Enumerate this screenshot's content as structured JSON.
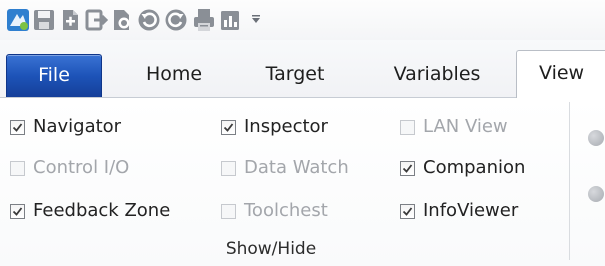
{
  "quick_access": {
    "icons": [
      "app-logo-icon",
      "save-icon",
      "add-file-icon",
      "export-icon",
      "settings-file-icon",
      "undo-icon",
      "redo-icon",
      "print-icon",
      "chart-icon",
      "customize-dropdown-icon"
    ]
  },
  "tabs": [
    {
      "label": "File"
    },
    {
      "label": "Home"
    },
    {
      "label": "Target"
    },
    {
      "label": "Variables"
    },
    {
      "label": "View"
    }
  ],
  "show_hide": {
    "group_label": "Show/Hide",
    "items": [
      {
        "label": "Navigator",
        "checked": true,
        "enabled": true
      },
      {
        "label": "Control I/O",
        "checked": false,
        "enabled": false
      },
      {
        "label": "Feedback Zone",
        "checked": true,
        "enabled": true
      },
      {
        "label": "Inspector",
        "checked": true,
        "enabled": true
      },
      {
        "label": "Data Watch",
        "checked": false,
        "enabled": false
      },
      {
        "label": "Toolchest",
        "checked": false,
        "enabled": false
      },
      {
        "label": "LAN View",
        "checked": false,
        "enabled": false
      },
      {
        "label": "Companion",
        "checked": true,
        "enabled": true
      },
      {
        "label": "InfoViewer",
        "checked": true,
        "enabled": true
      }
    ]
  },
  "colors": {
    "file_tab": "#1d53b8",
    "tab_text": "#1e1e1e",
    "disabled_text": "#a3a6ab"
  }
}
